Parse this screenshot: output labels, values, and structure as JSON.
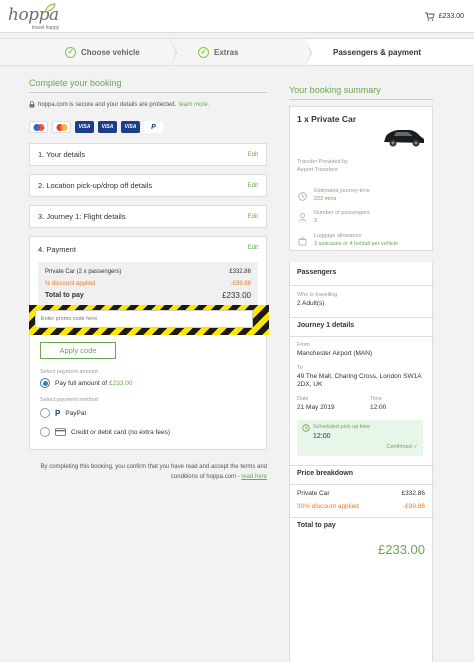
{
  "header": {
    "logo_text": "hoppa",
    "logo_tagline": "travel happy",
    "cart_total": "£233.00"
  },
  "steps": [
    {
      "label": "Choose vehicle",
      "state": "done"
    },
    {
      "label": "Extras",
      "state": "done"
    },
    {
      "label": "Passengers & payment",
      "state": "current"
    }
  ],
  "main": {
    "title": "Complete your booking",
    "secure_text": "hoppa.com is secure and your details are protected.",
    "learn_more": "learn more.",
    "cards": [
      "Maestro",
      "Mastercard",
      "VISA",
      "VISA",
      "VISA",
      "PayPal"
    ],
    "sections": [
      {
        "label": "1. Your details",
        "edit": "Edit"
      },
      {
        "label": "2. Location pick-up/drop off details",
        "edit": "Edit"
      },
      {
        "label": "3. Journey 1: Flight details",
        "edit": "Edit"
      }
    ],
    "payment": {
      "label": "4. Payment",
      "edit": "Edit",
      "private_car_label": "Private Car (2 x passengers)",
      "private_car_amount": "£332.86",
      "discount_label": "% discount applied",
      "discount_amount": "-£99.86",
      "total_label": "Total to pay",
      "total_amount": "£233.00",
      "promo_placeholder": "Enter promo code here",
      "apply_label": "Apply code",
      "amount_label": "Select payment amount",
      "pay_full_prefix": "Pay full amount of",
      "pay_full_amount": "£233.00",
      "method_label": "Select payment method",
      "paypal_label": "PayPal",
      "card_label": "Credit or debit card (no extra fees)"
    },
    "footnote_text": "By completing this booking, you confirm that you have read and accept the terms and conditions of hoppa.com -",
    "footnote_link": "read here"
  },
  "summary": {
    "title": "Your booking summary",
    "vehicle": "1 x Private Car",
    "provider_label": "Transfer Provided by",
    "provider": "Airport Transfers",
    "journey_time_label": "Estimated journey time",
    "journey_time": "222 mins",
    "passengers_label": "Number of passengers",
    "passengers": "2",
    "luggage_label": "Luggage allowance",
    "luggage": "3 suitcases or 4 holdall per vehicle",
    "passengers_heading": "Passengers",
    "who_label": "Who is travelling",
    "who": "2 Adult(s)",
    "journey_heading": "Journey 1 details",
    "from_label": "From",
    "from": "Manchester Airport (MAN)",
    "to_label": "To",
    "to": "49 The Mall, Charing Cross, London SW1A 2DX, UK",
    "date_label": "Date",
    "date": "21 May 2019",
    "time_label": "Time",
    "time": "12:00",
    "sched_label": "Scheduled pick-up time",
    "sched_time": "12:00",
    "confirmed": "Confirmed",
    "breakdown_heading": "Price breakdown",
    "bd_car_label": "Private Car",
    "bd_car_amount": "£332.86",
    "bd_discount_label": "30% discount applied",
    "bd_discount_amount": "-£99.86",
    "total_heading": "Total to pay",
    "total_amount": "£233.00"
  },
  "colors": {
    "accent_green": "#6aa84f",
    "discount_orange": "#e67e22",
    "radio_blue": "#2a7fd1"
  }
}
